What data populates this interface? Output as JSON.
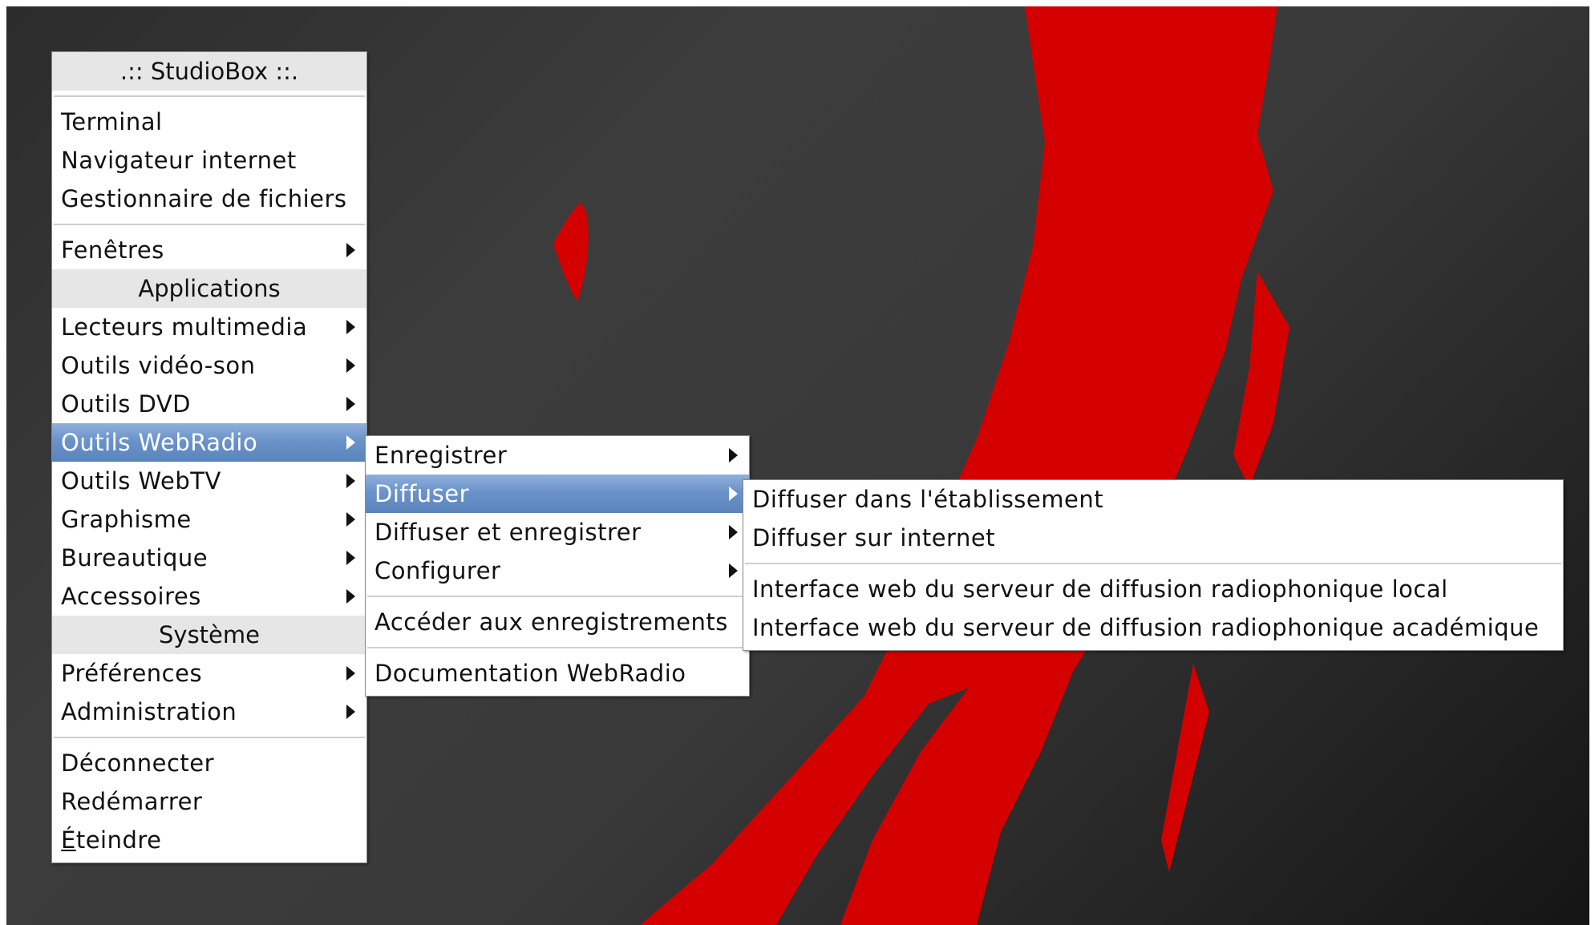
{
  "colors": {
    "wallpaper_red": "#d40000",
    "menu_bg": "#ffffff",
    "menu_header_bg": "#e6e6e6",
    "highlight": "#6b93c9"
  },
  "main_menu": {
    "title": ".:: StudioBox ::.",
    "items_top": [
      "Terminal",
      "Navigateur internet",
      "Gestionnaire de fichiers"
    ],
    "windows_label": "Fenêtres",
    "applications_header": "Applications",
    "applications": [
      "Lecteurs multimedia",
      "Outils vidéo-son",
      "Outils DVD",
      "Outils WebRadio",
      "Outils WebTV",
      "Graphisme",
      "Bureautique",
      "Accessoires"
    ],
    "system_header": "Système",
    "system": [
      "Préférences",
      "Administration"
    ],
    "session": [
      "Déconnecter",
      "Redémarrer"
    ],
    "shutdown_first": "É",
    "shutdown_rest": "teindre"
  },
  "webradio_menu": {
    "items": [
      "Enregistrer",
      "Diffuser",
      "Diffuser et enregistrer",
      "Configurer"
    ],
    "recordings": "Accéder aux enregistrements",
    "documentation": "Documentation WebRadio"
  },
  "diffuser_menu": {
    "items": [
      "Diffuser dans l'établissement",
      "Diffuser sur internet"
    ],
    "interfaces": [
      "Interface web du serveur de diffusion radiophonique local",
      "Interface web du serveur de diffusion radiophonique académique"
    ]
  }
}
